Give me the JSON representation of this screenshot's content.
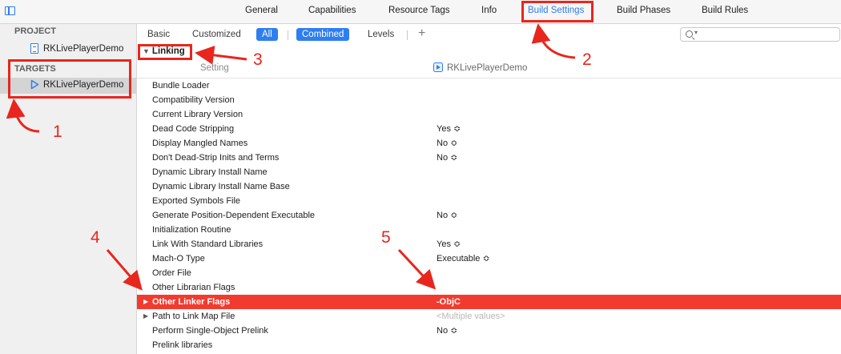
{
  "toolbar": {
    "tabs": [
      {
        "label": "General"
      },
      {
        "label": "Capabilities"
      },
      {
        "label": "Resource Tags"
      },
      {
        "label": "Info"
      },
      {
        "label": "Build Settings"
      },
      {
        "label": "Build Phases"
      },
      {
        "label": "Build Rules"
      }
    ],
    "active_tab": "Build Settings"
  },
  "sidebar": {
    "project_header": "PROJECT",
    "project_item": "RKLivePlayerDemo",
    "targets_header": "TARGETS",
    "target_item": "RKLivePlayerDemo"
  },
  "filters": {
    "basic": "Basic",
    "customized": "Customized",
    "all": "All",
    "combined": "Combined",
    "levels": "Levels",
    "add": "+"
  },
  "table": {
    "section": "Linking",
    "col_setting": "Setting",
    "col_target": "RKLivePlayerDemo",
    "rows": [
      {
        "name": "Bundle Loader",
        "value": ""
      },
      {
        "name": "Compatibility Version",
        "value": ""
      },
      {
        "name": "Current Library Version",
        "value": ""
      },
      {
        "name": "Dead Code Stripping",
        "value": "Yes ≎"
      },
      {
        "name": "Display Mangled Names",
        "value": "No ≎"
      },
      {
        "name": "Don't Dead-Strip Inits and Terms",
        "value": "No ≎"
      },
      {
        "name": "Dynamic Library Install Name",
        "value": ""
      },
      {
        "name": "Dynamic Library Install Name Base",
        "value": ""
      },
      {
        "name": "Exported Symbols File",
        "value": ""
      },
      {
        "name": "Generate Position-Dependent Executable",
        "value": "No ≎"
      },
      {
        "name": "Initialization Routine",
        "value": ""
      },
      {
        "name": "Link With Standard Libraries",
        "value": "Yes ≎"
      },
      {
        "name": "Mach-O Type",
        "value": "Executable ≎"
      },
      {
        "name": "Order File",
        "value": ""
      },
      {
        "name": "Other Librarian Flags",
        "value": ""
      },
      {
        "name": "Other Linker Flags",
        "value": "-ObjC"
      },
      {
        "name": "Path to Link Map File",
        "value": "<Multiple values>"
      },
      {
        "name": "Perform Single-Object Prelink",
        "value": "No ≎"
      },
      {
        "name": "Prelink libraries",
        "value": ""
      }
    ]
  },
  "annotations": {
    "labels": [
      "1",
      "2",
      "3",
      "4",
      "5"
    ],
    "color": "#e8261d"
  },
  "colors": {
    "accent": "#2e7ef0",
    "highlight_row": "#f23b2f"
  }
}
